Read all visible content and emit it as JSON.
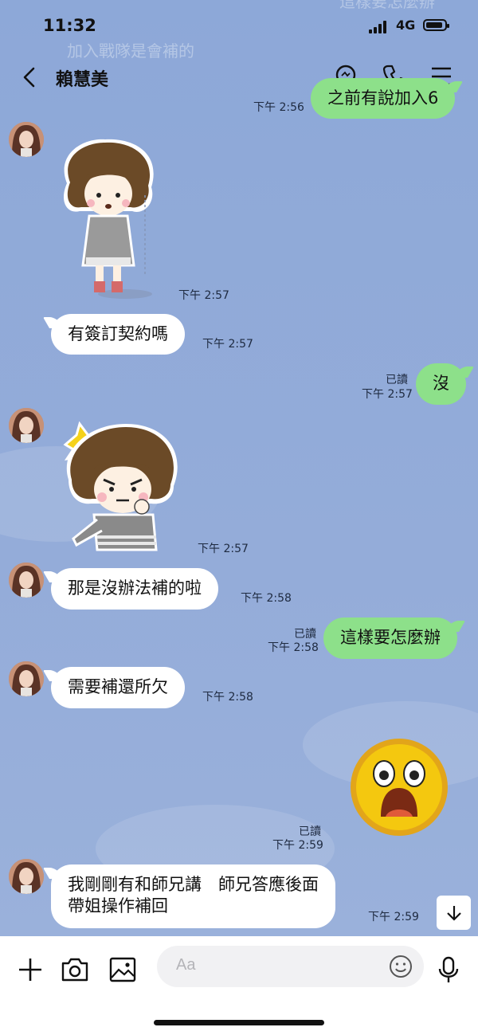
{
  "status_bar": {
    "time": "11:32",
    "network": "4G"
  },
  "ghost": {
    "top_right": "這樣要怎麼辦",
    "left": "加入戰隊是會補的"
  },
  "header": {
    "title": "賴慧美"
  },
  "messages": [
    {
      "side": "out",
      "text": "之前有說加入6",
      "time": "下午 2:56"
    },
    {
      "side": "in",
      "kind": "sticker",
      "sticker": "girl-standing-sticker",
      "time": "下午 2:57"
    },
    {
      "side": "in",
      "text": "有簽訂契約嗎",
      "time": "下午 2:57"
    },
    {
      "side": "out",
      "text": "沒",
      "read": "已讀",
      "time": "下午 2:57"
    },
    {
      "side": "in",
      "kind": "sticker",
      "sticker": "girl-angry-sticker",
      "time": "下午 2:57"
    },
    {
      "side": "in",
      "text": "那是沒辦法補的啦",
      "time": "下午 2:58"
    },
    {
      "side": "out",
      "text": "這樣要怎麼辦",
      "read": "已讀",
      "time": "下午 2:58"
    },
    {
      "side": "in",
      "text": "需要補還所欠",
      "time": "下午 2:58"
    },
    {
      "side": "out",
      "kind": "sticker",
      "sticker": "shocked-face-emoji",
      "read": "已讀",
      "time": "下午 2:59"
    },
    {
      "side": "in",
      "text_line1": "我剛剛有和師兄講　師兄答應後面",
      "text_line2": "帶姐操作補回",
      "time": "下午 2:59"
    }
  ],
  "composer": {
    "placeholder": "Aa"
  },
  "icons": {
    "header": [
      "back-icon",
      "search-icon",
      "phone-icon",
      "menu-icon"
    ],
    "bottom": [
      "plus-icon",
      "camera-icon",
      "image-icon",
      "emoji-icon",
      "mic-icon"
    ],
    "scroll": "arrow-down-icon"
  },
  "colors": {
    "chat_bg": "#8fa9d8",
    "outgoing_bubble": "#8de08a",
    "incoming_bubble": "#ffffff"
  }
}
